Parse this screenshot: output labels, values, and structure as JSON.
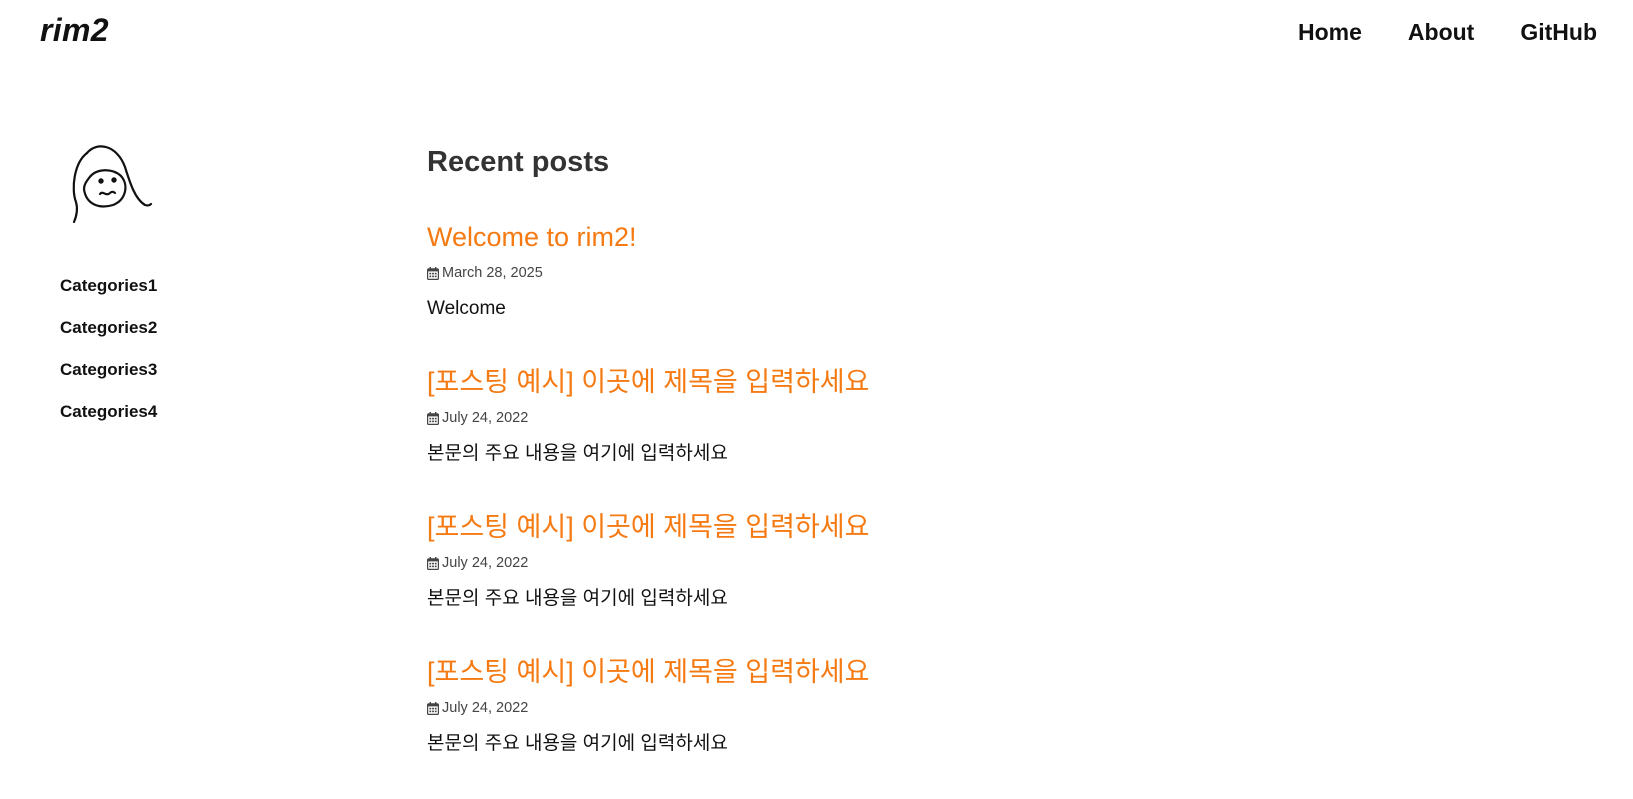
{
  "header": {
    "brand": "rim2",
    "nav": [
      {
        "label": "Home"
      },
      {
        "label": "About"
      },
      {
        "label": "GitHub"
      }
    ]
  },
  "sidebar": {
    "avatar_icon": "face-doodle-icon",
    "categories": [
      {
        "label": "Categories1"
      },
      {
        "label": "Categories2"
      },
      {
        "label": "Categories3"
      },
      {
        "label": "Categories4"
      }
    ]
  },
  "main": {
    "section_title": "Recent posts",
    "posts": [
      {
        "title": "Welcome to rim2!",
        "date": "March 28, 2025",
        "excerpt": "Welcome"
      },
      {
        "title": "[포스팅 예시] 이곳에 제목을 입력하세요",
        "date": "July 24, 2022",
        "excerpt": "본문의 주요 내용을 여기에 입력하세요"
      },
      {
        "title": "[포스팅 예시] 이곳에 제목을 입력하세요",
        "date": "July 24, 2022",
        "excerpt": "본문의 주요 내용을 여기에 입력하세요"
      },
      {
        "title": "[포스팅 예시] 이곳에 제목을 입력하세요",
        "date": "July 24, 2022",
        "excerpt": "본문의 주요 내용을 여기에 입력하세요"
      }
    ]
  },
  "colors": {
    "accent": "#f57a12",
    "text": "#111111",
    "heading": "#333333",
    "meta": "#444444"
  }
}
